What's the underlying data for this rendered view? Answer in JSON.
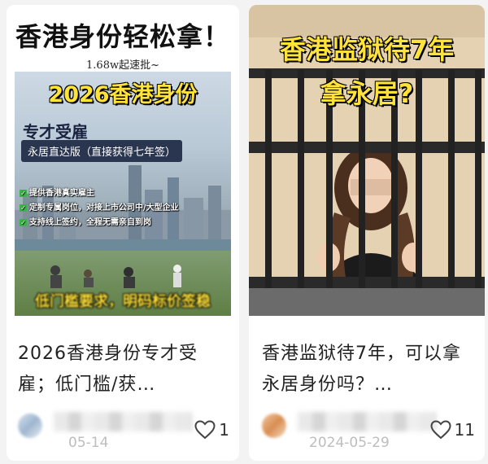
{
  "cards": [
    {
      "cover": {
        "title": "香港身份轻松拿！",
        "subtitle": "1.68w起速批~",
        "headline": "2026香港身份",
        "scheme": "专才受雇",
        "badge": "永居直达版（直接获得七年签）",
        "bullets": [
          "提供香港真实雇主",
          "定制专属岗位，对接上市公司中/大型企业",
          "支持线上签约，全程无需亲自到岗"
        ],
        "bottom": "低门槛要求，明码标价签稳"
      },
      "title": "2026香港身份专才受雇；低门槛/获…",
      "date": "05-14",
      "likes": "1"
    },
    {
      "cover": {
        "headline_line1": "香港监狱待7年",
        "headline_line2": "拿永居?"
      },
      "title": "香港监狱待7年，可以拿永居身份吗？…",
      "date": "2024-05-29",
      "likes": "11"
    }
  ],
  "colors": {
    "accent_yellow": "#ffe23a",
    "like_gray": "#333333",
    "date_gray": "#bdbdbd"
  }
}
